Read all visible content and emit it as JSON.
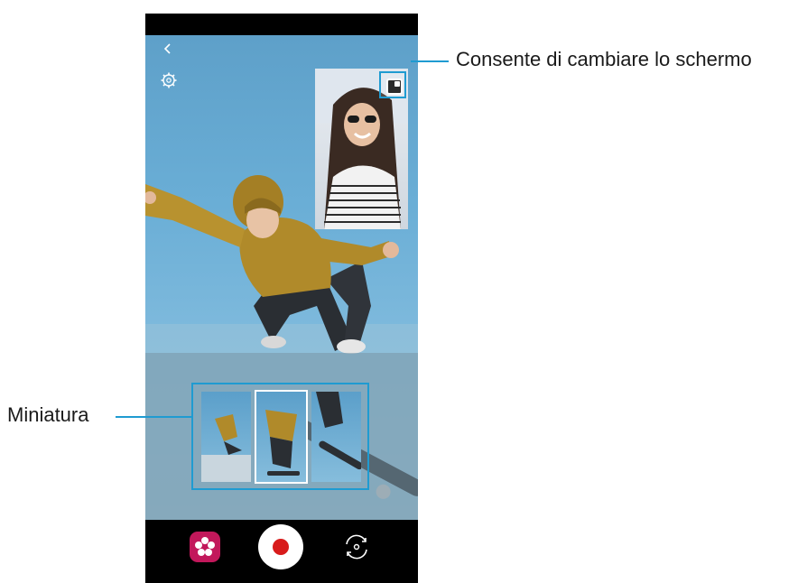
{
  "callouts": {
    "switch_screen": "Consente di cambiare lo schermo",
    "thumbnail": "Miniatura"
  },
  "icons": {
    "back": "back-arrow-icon",
    "settings": "gear-icon",
    "swap_view": "swap-screen-icon",
    "filter": "filter-icon",
    "record": "record-icon",
    "flip_camera": "flip-camera-icon"
  },
  "thumbnails": [
    {
      "state": "normal"
    },
    {
      "state": "selected"
    },
    {
      "state": "normal"
    }
  ],
  "colors": {
    "accent": "#1f9bd1",
    "record": "#d81b1b",
    "filter": "#c2185b"
  }
}
